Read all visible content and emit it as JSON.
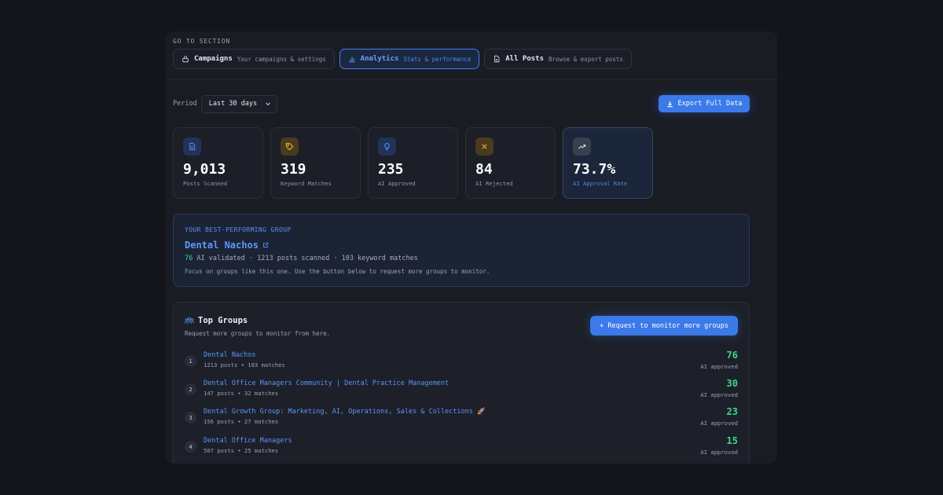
{
  "nav": {
    "heading": "GO TO SECTION",
    "tabs": [
      {
        "label": "Campaigns",
        "sub": "Your campaigns & settings",
        "icon": "lock-icon"
      },
      {
        "label": "Analytics",
        "sub": "Stats & performance",
        "icon": "bar-chart-icon",
        "active": true
      },
      {
        "label": "All Posts",
        "sub": "Browse & export posts",
        "icon": "document-icon"
      }
    ]
  },
  "toolbar": {
    "period_label": "Period",
    "period_value": "Last 30 days",
    "export_label": "Export Full Data"
  },
  "stats": [
    {
      "value": "9,013",
      "label": "Posts Scanned",
      "icon": "document-icon",
      "color": "#5b8ef0"
    },
    {
      "value": "319",
      "label": "Keyword Matches",
      "icon": "tag-icon",
      "color": "#f0b43c"
    },
    {
      "value": "235",
      "label": "AI Approved",
      "icon": "lightbulb-icon",
      "color": "#5b8ef0"
    },
    {
      "value": "84",
      "label": "AI Rejected",
      "icon": "x-icon",
      "color": "#f0b43c"
    },
    {
      "value": "73.7%",
      "label": "AI Approval Rate",
      "icon": "trend-up-icon",
      "color": "#e6e8ee"
    }
  ],
  "best_group": {
    "eyebrow": "YOUR BEST-PERFORMING GROUP",
    "name": "Dental Nachos",
    "validated": "76",
    "meta_rest": "AI validated · 1213 posts scanned · 103 keyword matches",
    "note": "Focus on groups like this one. Use the button below to request more groups to monitor."
  },
  "top_groups": {
    "title": "Top Groups",
    "subtitle": "Request more groups to monitor from here.",
    "request_button": "+ Request to monitor more groups",
    "approved_label": "AI approved",
    "rows": [
      {
        "rank": "1",
        "name": "Dental Nachos",
        "meta": "1213 posts • 103 matches",
        "count": "76"
      },
      {
        "rank": "2",
        "name": "Dental Office Managers Community | Dental Practice Management",
        "meta": "147 posts • 32 matches",
        "count": "30"
      },
      {
        "rank": "3",
        "name": "Dental Growth Group: Marketing, AI, Operations, Sales & Collections 🚀",
        "meta": "156 posts • 27 matches",
        "count": "23"
      },
      {
        "rank": "4",
        "name": "Dental Office Managers",
        "meta": "507 posts • 25 matches",
        "count": "15"
      }
    ]
  },
  "colors": {
    "accent": "#3b7ae8",
    "success": "#43d38e",
    "background": "#14151b"
  }
}
